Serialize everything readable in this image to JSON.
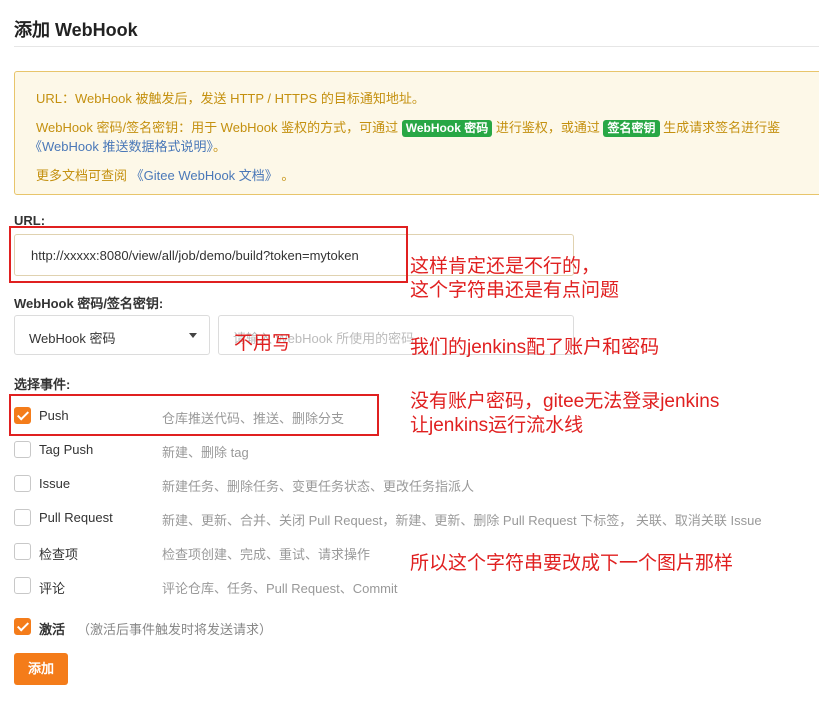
{
  "page": {
    "title": "添加 WebHook"
  },
  "notice": {
    "url_line": "URL：WebHook 被触发后，发送 HTTP / HTTPS 的目标通知地址。",
    "secret_prefix": "WebHook 密码/签名密钥：用于 WebHook 鉴权的方式，可通过",
    "tag_password": "WebHook 密码",
    "secret_mid": "进行鉴权，或通过",
    "tag_sign": "签名密钥",
    "secret_suffix": "生成请求签名进行鉴",
    "format_link": "《WebHook 推送数据格式说明》",
    "format_tail": "。",
    "docs_prefix": "更多文档可查阅",
    "docs_link": "《Gitee WebHook 文档》",
    "docs_tail": "。"
  },
  "form": {
    "url_label": "URL:",
    "url_value": "http://xxxxx:8080/view/all/job/demo/build?token=mytoken",
    "secret_label": "WebHook 密码/签名密钥:",
    "secret_type": "WebHook 密码",
    "secret_placeholder": "请输入 WebHook 所使用的密码",
    "events_label": "选择事件:"
  },
  "events": [
    {
      "name": "Push",
      "desc": "仓库推送代码、推送、删除分支",
      "checked": true
    },
    {
      "name": "Tag Push",
      "desc": "新建、删除 tag",
      "checked": false
    },
    {
      "name": "Issue",
      "desc": "新建任务、删除任务、变更任务状态、更改任务指派人",
      "checked": false
    },
    {
      "name": "Pull Request",
      "desc": "新建、更新、合并、关闭 Pull Request，新建、更新、删除 Pull Request 下标签， 关联、取消关联 Issue",
      "checked": false
    },
    {
      "name": "检查项",
      "desc": "检查项创建、完成、重试、请求操作",
      "checked": false
    },
    {
      "name": "评论",
      "desc": "评论仓库、任务、Pull Request、Commit",
      "checked": false
    }
  ],
  "activate": {
    "label": "激活",
    "hint": "（激活后事件触发时将发送请求）",
    "checked": true
  },
  "submit_label": "添加",
  "annotations": {
    "note1_line1": "这样肯定还是不行的，",
    "note1_line2": "这个字符串还是有点问题",
    "note_no_need": "不用写",
    "note2": "我们的jenkins配了账户和密码",
    "note3_line1": "没有账户密码，gitee无法登录jenkins",
    "note3_line2": "让jenkins运行流水线",
    "note4": "所以这个字符串要改成下一个图片那样"
  },
  "colors": {
    "accent": "#f47c1a",
    "annotation": "#e02020",
    "tag_green": "#28a745",
    "notice_text": "#c4900f",
    "link": "#4a78b8"
  }
}
